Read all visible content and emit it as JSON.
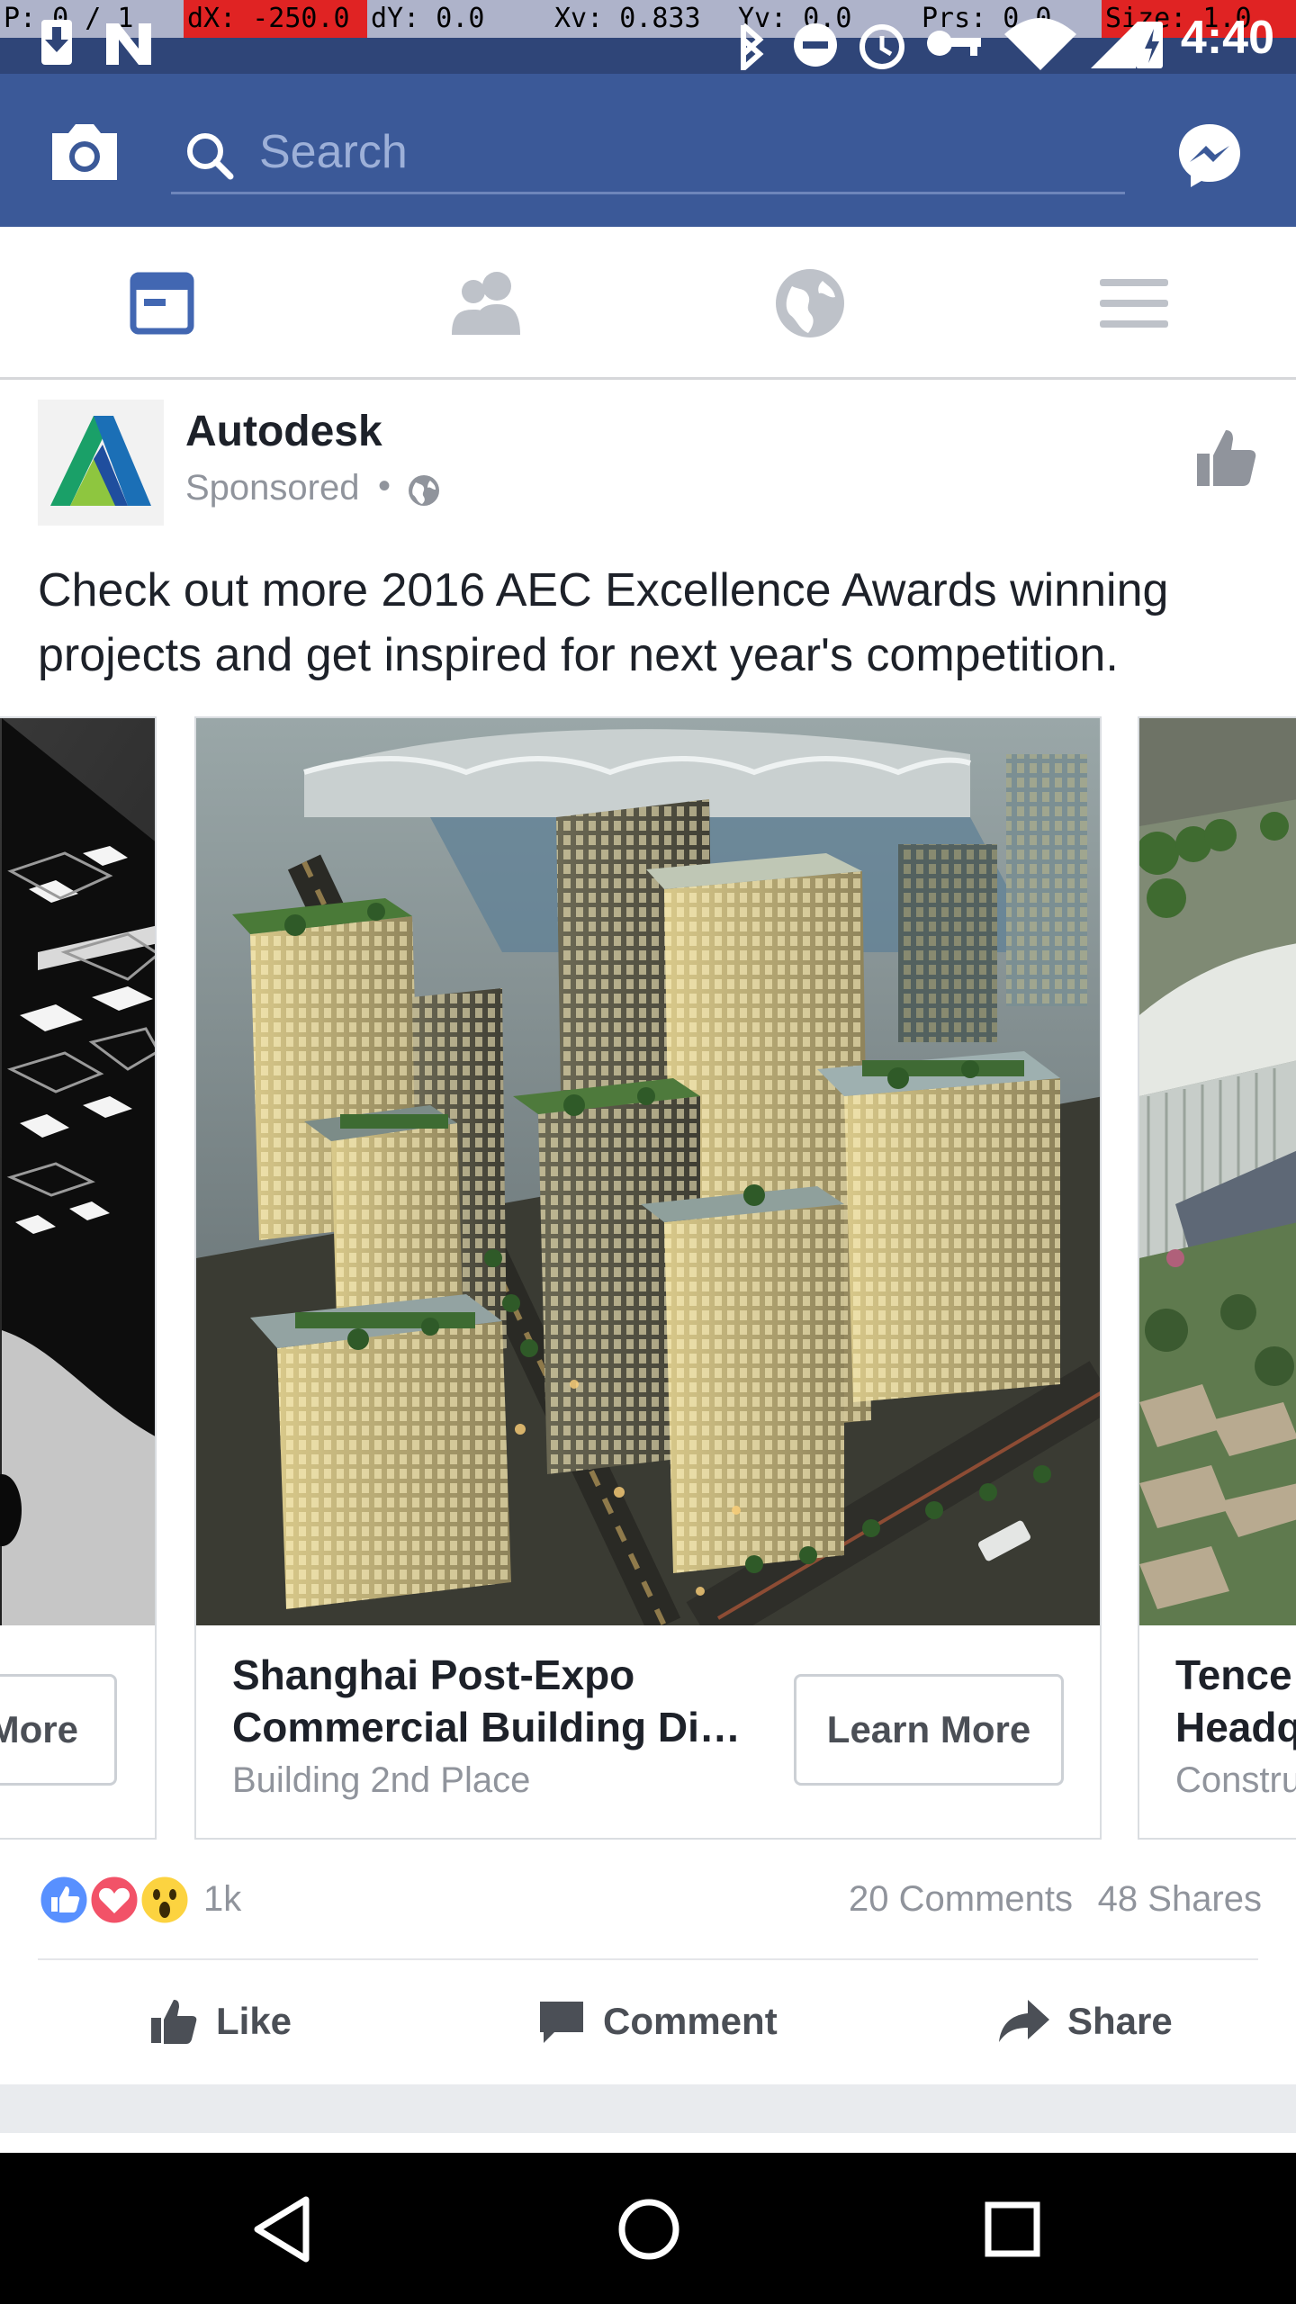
{
  "debug": {
    "pointer": "P: 0 / 1",
    "dx": "dX: -250.0",
    "dy": "dY: 0.0",
    "xv": "Xv: 0.833",
    "yv": "Yv: 0.0",
    "prs": "Prs: 0.0",
    "size": "Size: 1.0"
  },
  "status_bar": {
    "time": "4:40"
  },
  "search": {
    "placeholder": "Search"
  },
  "post": {
    "page_name": "Autodesk",
    "sponsored": "Sponsored",
    "separator": "•",
    "text": "Check out more 2016 AEC Excellence Awards winning projects and get inspired for next year's competition."
  },
  "carousel": {
    "left_card": {
      "cta_partial": "More"
    },
    "center_card": {
      "title_line1": "Shanghai Post-Expo",
      "title_line2": "Commercial Building Dist…",
      "subtitle": "Building 2nd Place",
      "cta": "Learn More"
    },
    "right_card": {
      "title_line1": "Tence",
      "title_line2": "Headq",
      "subtitle": "Constru"
    }
  },
  "engagement": {
    "reaction_count": "1k",
    "comments": "20 Comments",
    "shares": "48 Shares"
  },
  "actions": {
    "like": "Like",
    "comment": "Comment",
    "share": "Share"
  },
  "colors": {
    "brand": "#3b5998",
    "status": "#2f4578",
    "accent": "#4267b2"
  }
}
